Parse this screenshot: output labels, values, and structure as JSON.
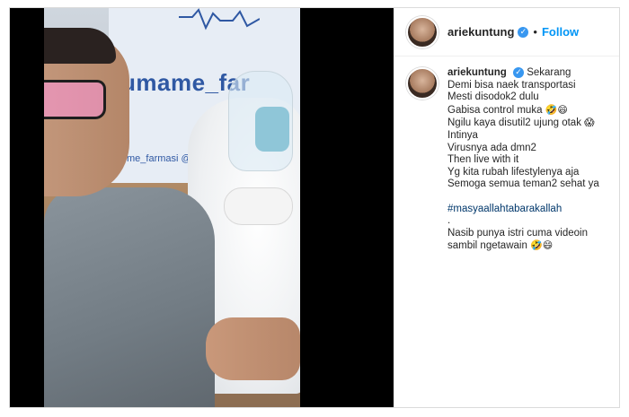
{
  "post": {
    "username": "ariekuntung",
    "follow_label": "Follow",
    "separator": "•",
    "verified_glyph": "✓"
  },
  "video": {
    "banner_text_main": "umame_far",
    "banner_text_small": "me_farmasi @"
  },
  "caption": {
    "username": "ariekuntung",
    "lines": [
      "Sekarang",
      "Demi bisa naek transportasi",
      "Mesti disodok2 dulu",
      "Gabisa control muka",
      "Ngilu kaya disutil2 ujung otak",
      "Intinya",
      "Virusnya ada dmn2",
      "Then live with it",
      "Yg kita rubah lifestylenya aja",
      "Semoga semua teman2 sehat ya"
    ],
    "emoji_line4": "🤣😄",
    "emoji_line5": "😱",
    "hashtag": "#masyaallahtabarakallah",
    "dot_line": ".",
    "closing_line1": "Nasib punya istri cuma videoin",
    "closing_line2": "sambil ngetawain",
    "closing_emoji": "🤣😄"
  }
}
